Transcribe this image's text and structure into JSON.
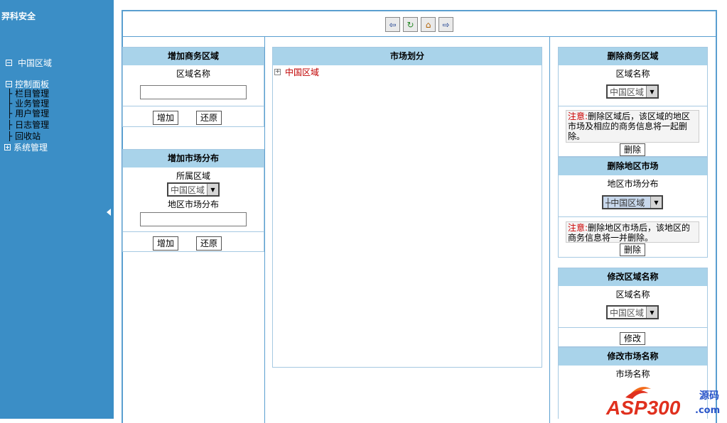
{
  "sidebar": {
    "brand": "羿科安全",
    "top_node": "中国区域",
    "control_panel": "控制面板",
    "children": [
      "栏目管理",
      "业务管理",
      "用户管理",
      "日志管理",
      "回收站"
    ],
    "system": "系统管理",
    "connector": "├"
  },
  "toolbar": {
    "back_icon": "⇦",
    "refresh_icon": "↻",
    "home_icon": "⌂",
    "forward_icon": "⇨"
  },
  "add_business_region": {
    "title": "增加商务区域",
    "region_name_label": "区域名称",
    "region_name_value": "",
    "add_label": "增加",
    "reset_label": "还原"
  },
  "add_market": {
    "title": "增加市场分布",
    "region_label": "所属区域",
    "region_selected": "中国区域",
    "market_label": "地区市场分布",
    "market_value": "",
    "add_label": "增加",
    "reset_label": "还原"
  },
  "market_division": {
    "title": "市场划分",
    "root_node": "中国区域"
  },
  "delete_business_region": {
    "title": "删除商务区域",
    "region_name_label": "区域名称",
    "region_selected": "中国区域",
    "note_prefix": "注意:",
    "note_text": "删除区域后，该区域的地区市场及相应的商务信息将一起删除。",
    "delete_label": "删除"
  },
  "delete_market": {
    "title": "删除地区市场",
    "market_label": "地区市场分布",
    "market_selected": "┼中国区域",
    "note_prefix": "注意:",
    "note_text": "删除地区市场后，该地区的商务信息将一并删除。",
    "delete_label": "删除"
  },
  "rename_region": {
    "title": "修改区域名称",
    "region_name_label": "区域名称",
    "region_selected": "中国区域",
    "modify_label": "修改"
  },
  "rename_market": {
    "title": "修改市场名称",
    "market_name_label": "市场名称"
  },
  "watermark": {
    "text": "ASP300",
    "suffix_line1": "源码",
    "suffix_line2": ".com",
    "colors": {
      "brand_red": "#e0301e",
      "brand_blue": "#2a55c9"
    }
  },
  "colors": {
    "sidebar": "#3b8ec6",
    "panel_header": "#a9d3ea",
    "border": "#5a9fd0",
    "tree_node": "#c00000"
  }
}
